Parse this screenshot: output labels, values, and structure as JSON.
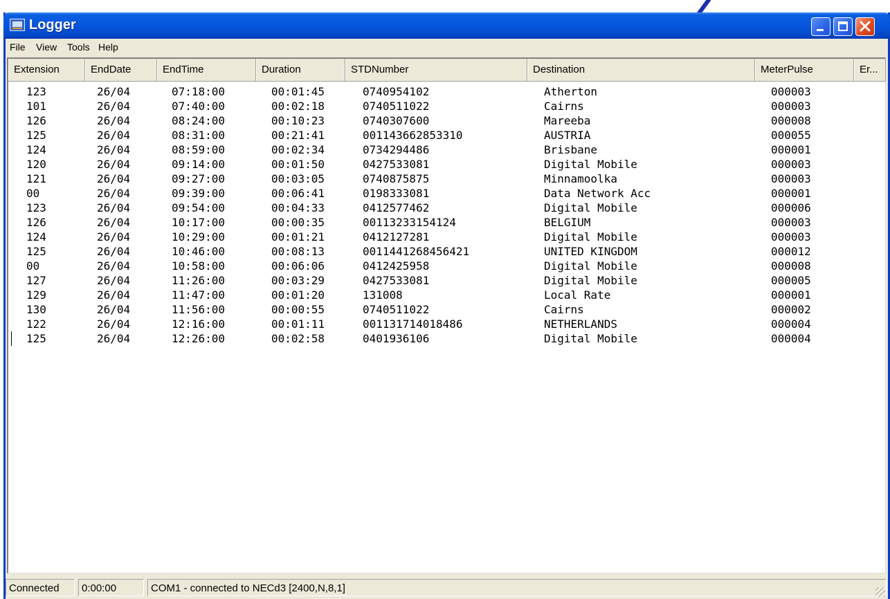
{
  "window": {
    "title": "Logger",
    "icon": "logger-app-icon",
    "controls": [
      "minimize-icon",
      "maximize-icon",
      "close-icon"
    ]
  },
  "menu": [
    "File",
    "View",
    "Tools",
    "Help"
  ],
  "columns": [
    "Extension",
    "EndDate",
    "EndTime",
    "Duration",
    "STDNumber",
    "Destination",
    "MeterPulse",
    "Er..."
  ],
  "rows": [
    [
      "123",
      "26/04",
      "07:18:00",
      "00:01:45",
      "0740954102",
      "Atherton",
      "000003"
    ],
    [
      "101",
      "26/04",
      "07:40:00",
      "00:02:18",
      "0740511022",
      "Cairns",
      "000003"
    ],
    [
      "126",
      "26/04",
      "08:24:00",
      "00:10:23",
      "0740307600",
      "Mareeba",
      "000008"
    ],
    [
      "125",
      "26/04",
      "08:31:00",
      "00:21:41",
      "001143662853310",
      "AUSTRIA",
      "000055"
    ],
    [
      "124",
      "26/04",
      "08:59:00",
      "00:02:34",
      "0734294486",
      "Brisbane",
      "000001"
    ],
    [
      "120",
      "26/04",
      "09:14:00",
      "00:01:50",
      "0427533081",
      "Digital Mobile",
      "000003"
    ],
    [
      "121",
      "26/04",
      "09:27:00",
      "00:03:05",
      "0740875875",
      "Minnamoolka",
      "000003"
    ],
    [
      "00",
      "26/04",
      "09:39:00",
      "00:06:41",
      "0198333081",
      "Data Network Acc",
      "000001"
    ],
    [
      "123",
      "26/04",
      "09:54:00",
      "00:04:33",
      "0412577462",
      "Digital Mobile",
      "000006"
    ],
    [
      "126",
      "26/04",
      "10:17:00",
      "00:00:35",
      "00113233154124",
      "BELGIUM",
      "000003"
    ],
    [
      "124",
      "26/04",
      "10:29:00",
      "00:01:21",
      "0412127281",
      "Digital Mobile",
      "000003"
    ],
    [
      "125",
      "26/04",
      "10:46:00",
      "00:08:13",
      "0011441268456421",
      "UNITED KINGDOM",
      "000012"
    ],
    [
      "00",
      "26/04",
      "10:58:00",
      "00:06:06",
      "0412425958",
      "Digital Mobile",
      "000008"
    ],
    [
      "127",
      "26/04",
      "11:26:00",
      "00:03:29",
      "0427533081",
      "Digital Mobile",
      "000005"
    ],
    [
      "129",
      "26/04",
      "11:47:00",
      "00:01:20",
      "131008",
      "Local Rate",
      "000001"
    ],
    [
      "130",
      "26/04",
      "11:56:00",
      "00:00:55",
      "0740511022",
      "Cairns",
      "000002"
    ],
    [
      "122",
      "26/04",
      "12:16:00",
      "00:01:11",
      "001131714018486",
      "NETHERLANDS",
      "000004"
    ],
    [
      "125",
      "26/04",
      "12:26:00",
      "00:02:58",
      "0401936106",
      "Digital Mobile",
      "000004"
    ]
  ],
  "status": {
    "connection": "Connected",
    "timer": "0:00:00",
    "port": "COM1 - connected to NECd3 [2400,N,8,1]"
  },
  "colors": {
    "titlebar": "#0655dd",
    "close_button": "#df4a22",
    "chrome": "#ece9d8"
  }
}
